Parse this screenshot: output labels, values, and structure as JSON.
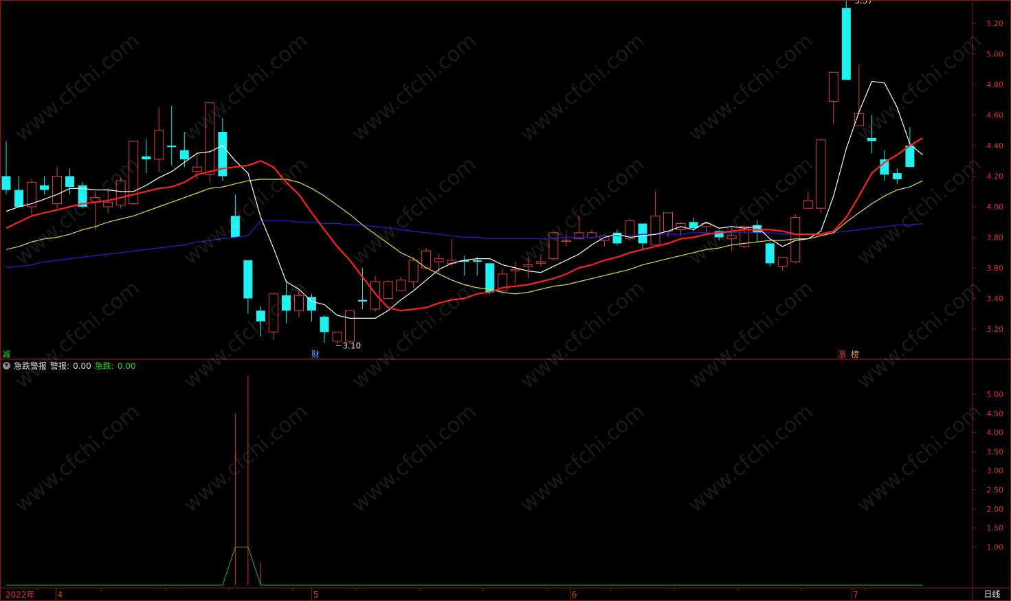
{
  "colors": {
    "background": "#000000",
    "frame": "#8b1a1a",
    "axis_text": "#e03030",
    "up_candle": "#e04040",
    "down_candle": "#1ff0f0",
    "ma5": "#ffffff",
    "ma10": "#ff2020",
    "ma20": "#e0e040",
    "ma60": "#2020e0",
    "indicator_spike": "#e03030",
    "indicator_line": "#19c019"
  },
  "watermark": "www.cfchi.com",
  "markers": {
    "high_label": "5.37",
    "low_label": "3.10",
    "badge_left": "减",
    "badge_mid": "财",
    "badge_right_1": "涨",
    "badge_right_2": "榜"
  },
  "indicator": {
    "name": "急跌警报",
    "field1_label": "警报:",
    "field1_value": "0.00",
    "field2_label": "急跌:",
    "field2_value": "0.00"
  },
  "time_axis": {
    "year_label": "2022年",
    "months": [
      "4",
      "5",
      "6",
      "7"
    ]
  },
  "frequency_label": "日线",
  "chart_data": [
    {
      "type": "candlestick",
      "yaxis_ticks": [
        "5.20",
        "5.00",
        "4.80",
        "4.60",
        "4.40",
        "4.20",
        "4.00",
        "3.80",
        "3.60",
        "3.40",
        "3.20"
      ],
      "ylim": [
        3.0,
        5.37
      ],
      "candles": [
        {
          "o": 4.2,
          "h": 4.43,
          "l": 4.08,
          "c": 4.11
        },
        {
          "o": 4.11,
          "h": 4.2,
          "l": 4.0,
          "c": 4.0
        },
        {
          "o": 4.0,
          "h": 4.18,
          "l": 3.95,
          "c": 4.16
        },
        {
          "o": 4.14,
          "h": 4.2,
          "l": 4.08,
          "c": 4.11
        },
        {
          "o": 4.02,
          "h": 4.26,
          "l": 3.99,
          "c": 4.2
        },
        {
          "o": 4.2,
          "h": 4.25,
          "l": 4.08,
          "c": 4.13
        },
        {
          "o": 4.14,
          "h": 4.16,
          "l": 3.99,
          "c": 4.0
        },
        {
          "o": 4.03,
          "h": 4.1,
          "l": 3.85,
          "c": 4.06
        },
        {
          "o": 4.0,
          "h": 4.12,
          "l": 3.96,
          "c": 4.03
        },
        {
          "o": 4.01,
          "h": 4.19,
          "l": 3.99,
          "c": 4.17
        },
        {
          "o": 4.02,
          "h": 4.43,
          "l": 4.01,
          "c": 4.43
        },
        {
          "o": 4.33,
          "h": 4.44,
          "l": 4.22,
          "c": 4.31
        },
        {
          "o": 4.31,
          "h": 4.65,
          "l": 4.23,
          "c": 4.5
        },
        {
          "o": 4.4,
          "h": 4.66,
          "l": 4.27,
          "c": 4.39
        },
        {
          "o": 4.37,
          "h": 4.49,
          "l": 4.26,
          "c": 4.31
        },
        {
          "o": 4.23,
          "h": 4.34,
          "l": 4.18,
          "c": 4.26
        },
        {
          "o": 4.21,
          "h": 4.68,
          "l": 4.16,
          "c": 4.68
        },
        {
          "o": 4.49,
          "h": 4.58,
          "l": 4.17,
          "c": 4.2
        },
        {
          "o": 3.94,
          "h": 4.08,
          "l": 3.8,
          "c": 3.8
        },
        {
          "o": 3.65,
          "h": 3.65,
          "l": 3.3,
          "c": 3.4
        },
        {
          "o": 3.32,
          "h": 3.35,
          "l": 3.15,
          "c": 3.25
        },
        {
          "o": 3.18,
          "h": 3.43,
          "l": 3.13,
          "c": 3.43
        },
        {
          "o": 3.42,
          "h": 3.52,
          "l": 3.24,
          "c": 3.32
        },
        {
          "o": 3.32,
          "h": 3.46,
          "l": 3.28,
          "c": 3.42
        },
        {
          "o": 3.41,
          "h": 3.43,
          "l": 3.25,
          "c": 3.32
        },
        {
          "o": 3.28,
          "h": 3.29,
          "l": 3.11,
          "c": 3.18
        },
        {
          "o": 3.12,
          "h": 3.18,
          "l": 3.1,
          "c": 3.18
        },
        {
          "o": 3.12,
          "h": 3.32,
          "l": 3.1,
          "c": 3.32
        },
        {
          "o": 3.39,
          "h": 3.6,
          "l": 3.33,
          "c": 3.38
        },
        {
          "o": 3.33,
          "h": 3.55,
          "l": 3.31,
          "c": 3.51
        },
        {
          "o": 3.4,
          "h": 3.52,
          "l": 3.4,
          "c": 3.51
        },
        {
          "o": 3.45,
          "h": 3.54,
          "l": 3.45,
          "c": 3.52
        },
        {
          "o": 3.51,
          "h": 3.67,
          "l": 3.47,
          "c": 3.65
        },
        {
          "o": 3.6,
          "h": 3.73,
          "l": 3.59,
          "c": 3.71
        },
        {
          "o": 3.64,
          "h": 3.69,
          "l": 3.56,
          "c": 3.66
        },
        {
          "o": 3.63,
          "h": 3.79,
          "l": 3.61,
          "c": 3.65
        },
        {
          "o": 3.65,
          "h": 3.68,
          "l": 3.55,
          "c": 3.64
        },
        {
          "o": 3.65,
          "h": 3.67,
          "l": 3.55,
          "c": 3.64
        },
        {
          "o": 3.63,
          "h": 3.63,
          "l": 3.43,
          "c": 3.44
        },
        {
          "o": 3.45,
          "h": 3.59,
          "l": 3.43,
          "c": 3.56
        },
        {
          "o": 3.58,
          "h": 3.64,
          "l": 3.5,
          "c": 3.59
        },
        {
          "o": 3.61,
          "h": 3.67,
          "l": 3.53,
          "c": 3.62
        },
        {
          "o": 3.63,
          "h": 3.69,
          "l": 3.61,
          "c": 3.64
        },
        {
          "o": 3.66,
          "h": 3.83,
          "l": 3.65,
          "c": 3.83
        },
        {
          "o": 3.78,
          "h": 3.82,
          "l": 3.74,
          "c": 3.78
        },
        {
          "o": 3.79,
          "h": 3.94,
          "l": 3.79,
          "c": 3.83
        },
        {
          "o": 3.8,
          "h": 3.85,
          "l": 3.79,
          "c": 3.83
        },
        {
          "o": 3.78,
          "h": 3.82,
          "l": 3.74,
          "c": 3.81
        },
        {
          "o": 3.83,
          "h": 3.85,
          "l": 3.75,
          "c": 3.76
        },
        {
          "o": 3.79,
          "h": 3.92,
          "l": 3.78,
          "c": 3.91
        },
        {
          "o": 3.89,
          "h": 3.89,
          "l": 3.72,
          "c": 3.76
        },
        {
          "o": 3.75,
          "h": 4.1,
          "l": 3.75,
          "c": 3.94
        },
        {
          "o": 3.84,
          "h": 3.96,
          "l": 3.8,
          "c": 3.96
        },
        {
          "o": 3.85,
          "h": 3.9,
          "l": 3.81,
          "c": 3.89
        },
        {
          "o": 3.9,
          "h": 3.93,
          "l": 3.84,
          "c": 3.86
        },
        {
          "o": 3.87,
          "h": 3.9,
          "l": 3.82,
          "c": 3.89
        },
        {
          "o": 3.84,
          "h": 3.85,
          "l": 3.78,
          "c": 3.8
        },
        {
          "o": 3.79,
          "h": 3.86,
          "l": 3.71,
          "c": 3.81
        },
        {
          "o": 3.74,
          "h": 3.83,
          "l": 3.73,
          "c": 3.87
        },
        {
          "o": 3.88,
          "h": 3.91,
          "l": 3.77,
          "c": 3.83
        },
        {
          "o": 3.76,
          "h": 3.77,
          "l": 3.61,
          "c": 3.63
        },
        {
          "o": 3.61,
          "h": 3.67,
          "l": 3.58,
          "c": 3.67
        },
        {
          "o": 3.64,
          "h": 3.95,
          "l": 3.63,
          "c": 3.93
        },
        {
          "o": 3.99,
          "h": 4.1,
          "l": 3.99,
          "c": 4.04
        },
        {
          "o": 3.99,
          "h": 4.43,
          "l": 3.96,
          "c": 4.44
        },
        {
          "o": 4.69,
          "h": 4.88,
          "l": 4.54,
          "c": 4.88
        },
        {
          "o": 5.3,
          "h": 5.37,
          "l": 4.83,
          "c": 4.83
        },
        {
          "o": 4.53,
          "h": 4.93,
          "l": 4.53,
          "c": 4.61
        },
        {
          "o": 4.45,
          "h": 4.6,
          "l": 4.35,
          "c": 4.43
        },
        {
          "o": 4.31,
          "h": 4.37,
          "l": 4.17,
          "c": 4.21
        },
        {
          "o": 4.22,
          "h": 4.25,
          "l": 4.15,
          "c": 4.18
        },
        {
          "o": 4.4,
          "h": 4.52,
          "l": 4.27,
          "c": 4.26
        }
      ],
      "ma5": [
        3.97,
        4.0,
        4.02,
        4.05,
        4.08,
        4.12,
        4.12,
        4.11,
        4.11,
        4.1,
        4.1,
        4.14,
        4.19,
        4.23,
        4.29,
        4.35,
        4.36,
        4.4,
        4.3,
        4.22,
        3.93,
        3.73,
        3.51,
        3.46,
        3.38,
        3.36,
        3.29,
        3.27,
        3.27,
        3.27,
        3.32,
        3.39,
        3.45,
        3.52,
        3.59,
        3.63,
        3.65,
        3.66,
        3.66,
        3.62,
        3.6,
        3.58,
        3.57,
        3.61,
        3.65,
        3.69,
        3.75,
        3.8,
        3.82,
        3.8,
        3.81,
        3.82,
        3.84,
        3.87,
        3.85,
        3.9,
        3.86,
        3.87,
        3.86,
        3.87,
        3.79,
        3.74,
        3.78,
        3.79,
        3.84,
        4.07,
        4.38,
        4.62,
        4.82,
        4.81,
        4.65,
        4.41,
        4.34
      ],
      "ma10": [
        3.86,
        3.9,
        3.94,
        3.96,
        3.98,
        4.0,
        4.02,
        4.03,
        4.04,
        4.06,
        4.08,
        4.1,
        4.12,
        4.13,
        4.16,
        4.21,
        4.23,
        4.25,
        4.26,
        4.27,
        4.3,
        4.26,
        4.16,
        4.08,
        3.96,
        3.85,
        3.74,
        3.65,
        3.54,
        3.43,
        3.34,
        3.32,
        3.33,
        3.34,
        3.37,
        3.39,
        3.4,
        3.43,
        3.44,
        3.47,
        3.48,
        3.49,
        3.51,
        3.53,
        3.56,
        3.6,
        3.62,
        3.65,
        3.67,
        3.7,
        3.72,
        3.74,
        3.76,
        3.79,
        3.8,
        3.82,
        3.83,
        3.84,
        3.85,
        3.85,
        3.85,
        3.84,
        3.82,
        3.82,
        3.82,
        3.84,
        3.93,
        4.07,
        4.22,
        4.29,
        4.34,
        4.4,
        4.45
      ],
      "ma20": [
        3.72,
        3.74,
        3.77,
        3.79,
        3.8,
        3.82,
        3.85,
        3.87,
        3.9,
        3.92,
        3.94,
        3.97,
        4.0,
        4.03,
        4.06,
        4.09,
        4.12,
        4.13,
        4.15,
        4.17,
        4.18,
        4.18,
        4.18,
        4.16,
        4.12,
        4.07,
        4.01,
        3.95,
        3.88,
        3.82,
        3.76,
        3.7,
        3.66,
        3.6,
        3.56,
        3.52,
        3.49,
        3.47,
        3.46,
        3.44,
        3.43,
        3.44,
        3.46,
        3.48,
        3.49,
        3.51,
        3.53,
        3.55,
        3.57,
        3.59,
        3.62,
        3.64,
        3.66,
        3.68,
        3.7,
        3.72,
        3.73,
        3.75,
        3.76,
        3.77,
        3.78,
        3.78,
        3.79,
        3.79,
        3.81,
        3.83,
        3.9,
        3.96,
        4.02,
        4.07,
        4.11,
        4.13,
        4.17
      ],
      "ma60": [
        3.6,
        3.61,
        3.62,
        3.64,
        3.65,
        3.66,
        3.67,
        3.68,
        3.69,
        3.7,
        3.71,
        3.72,
        3.73,
        3.74,
        3.75,
        3.77,
        3.78,
        3.79,
        3.8,
        3.81,
        3.91,
        3.91,
        3.91,
        3.9,
        3.9,
        3.89,
        3.89,
        3.88,
        3.88,
        3.87,
        3.86,
        3.85,
        3.84,
        3.83,
        3.82,
        3.81,
        3.8,
        3.8,
        3.79,
        3.79,
        3.79,
        3.79,
        3.79,
        3.79,
        3.8,
        3.8,
        3.8,
        3.81,
        3.81,
        3.81,
        3.82,
        3.82,
        3.82,
        3.82,
        3.83,
        3.83,
        3.83,
        3.83,
        3.83,
        3.83,
        3.83,
        3.82,
        3.82,
        3.82,
        3.82,
        3.83,
        3.84,
        3.85,
        3.86,
        3.87,
        3.88,
        3.88,
        3.89
      ]
    },
    {
      "type": "line",
      "name": "急跌警报",
      "yaxis_ticks": [
        "5.00",
        "4.50",
        "4.00",
        "3.50",
        "3.00",
        "2.50",
        "2.00",
        "1.50",
        "1.00"
      ],
      "ylim": [
        0,
        5.7
      ],
      "series": [
        {
          "name": "警报",
          "style": "stick",
          "values": [
            0,
            0,
            0,
            0,
            0,
            0,
            0,
            0,
            0,
            0,
            0,
            0,
            0,
            0,
            0,
            0,
            0,
            0,
            4.5,
            5.5,
            0.6,
            0,
            0,
            0,
            0,
            0,
            0,
            0,
            0,
            0,
            0,
            0,
            0,
            0,
            0,
            0,
            0,
            0,
            0,
            0,
            0,
            0,
            0,
            0,
            0,
            0,
            0,
            0,
            0,
            0,
            0,
            0,
            0,
            0,
            0,
            0,
            0,
            0,
            0,
            0,
            0,
            0,
            0,
            0,
            0,
            0,
            0,
            0,
            0,
            0,
            0,
            0,
            0
          ]
        },
        {
          "name": "急跌",
          "style": "line",
          "values": [
            0,
            0,
            0,
            0,
            0,
            0,
            0,
            0,
            0,
            0,
            0,
            0,
            0,
            0,
            0,
            0,
            0,
            0,
            1,
            1,
            0,
            0,
            0,
            0,
            0,
            0,
            0,
            0,
            0,
            0,
            0,
            0,
            0,
            0,
            0,
            0,
            0,
            0,
            0,
            0,
            0,
            0,
            0,
            0,
            0,
            0,
            0,
            0,
            0,
            0,
            0,
            0,
            0,
            0,
            0,
            0,
            0,
            0,
            0,
            0,
            0,
            0,
            0,
            0,
            0,
            0,
            0,
            0,
            0,
            0,
            0,
            0,
            0
          ]
        }
      ]
    }
  ]
}
